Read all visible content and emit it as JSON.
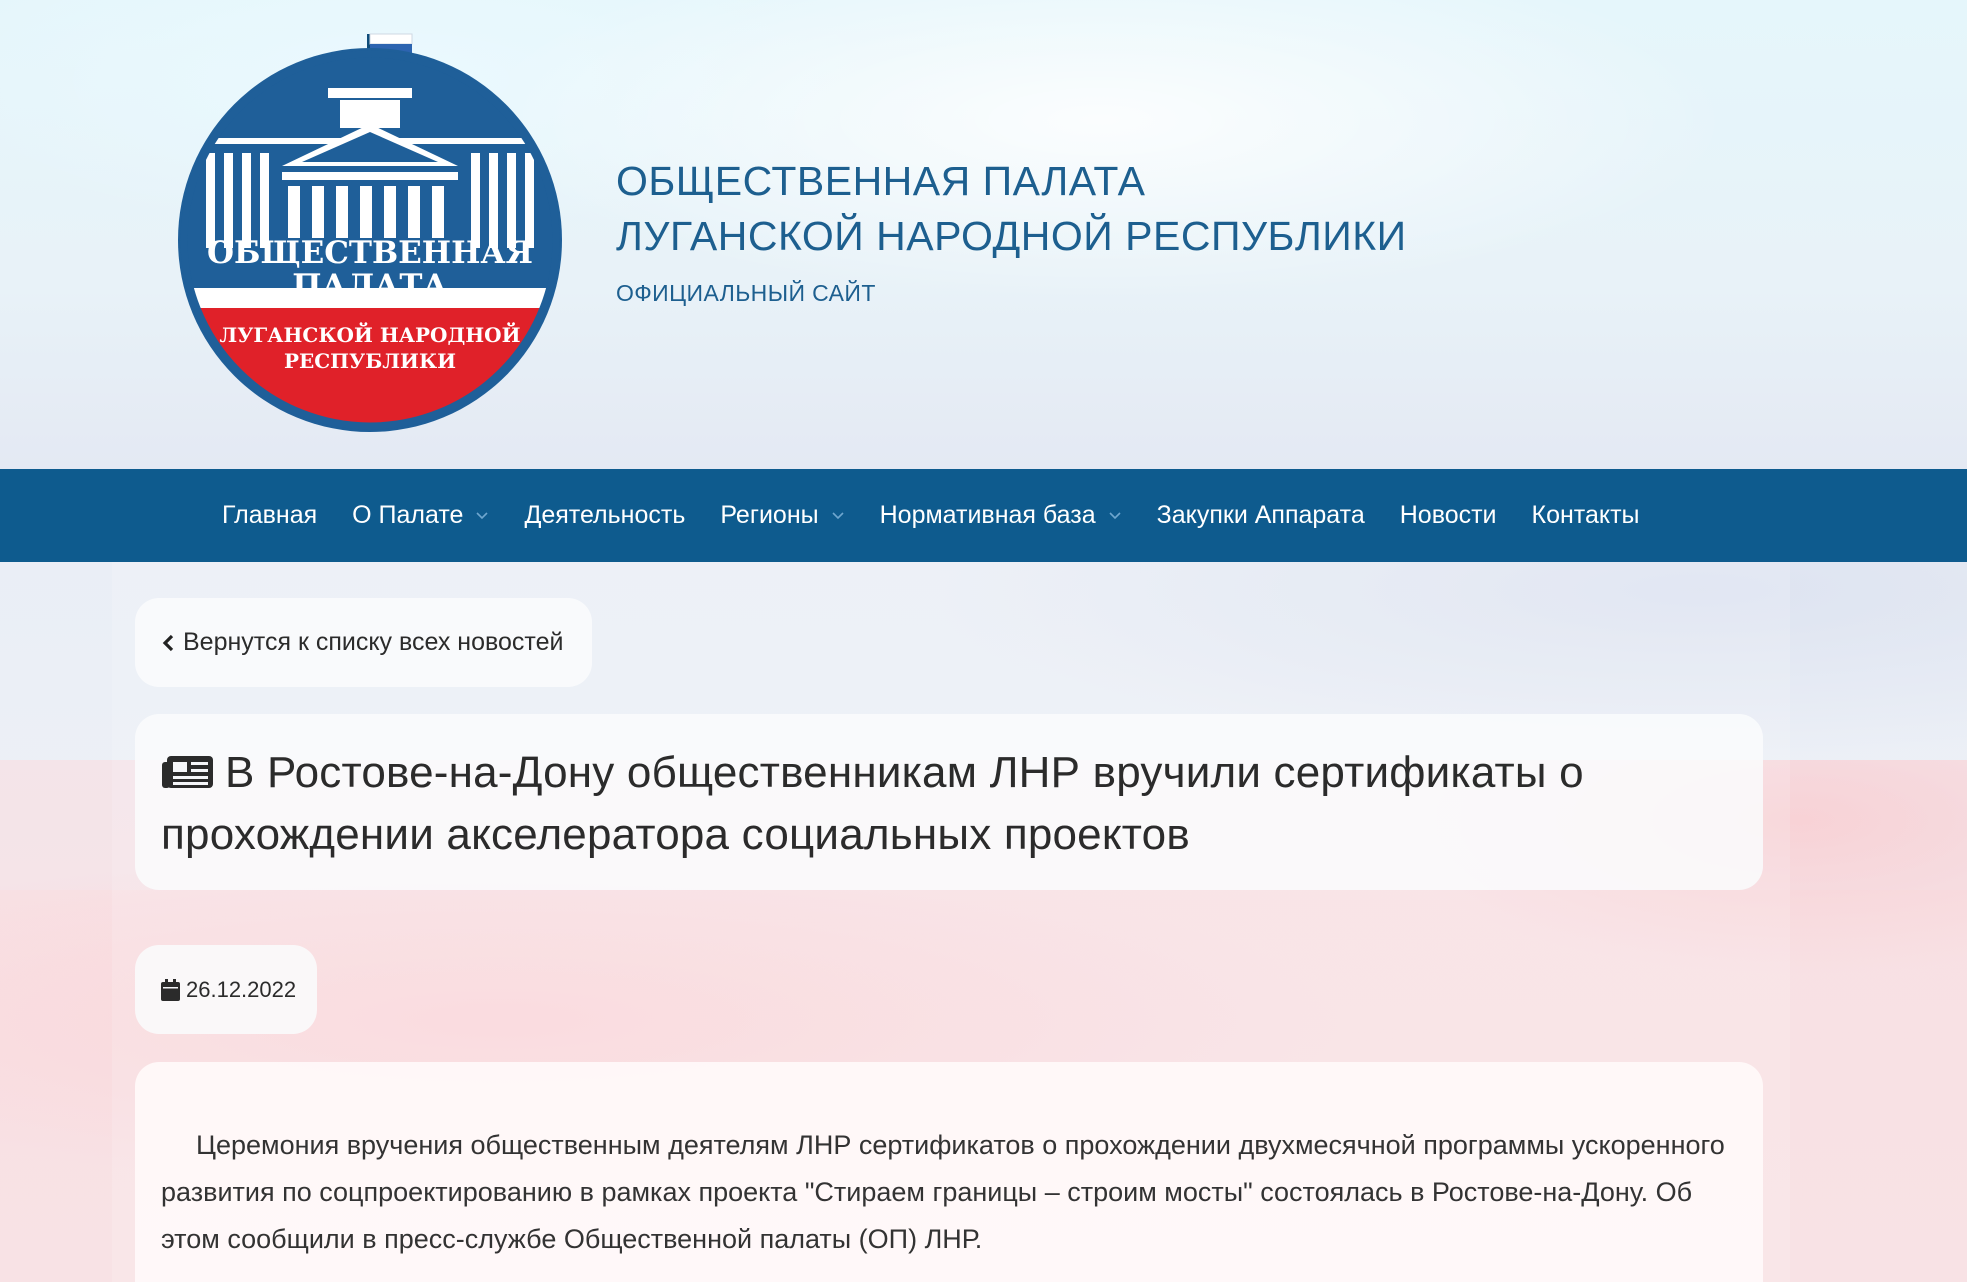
{
  "header": {
    "title_line1": "ОБЩЕСТВЕННАЯ ПАЛАТА",
    "title_line2": "ЛУГАНСКОЙ НАРОДНОЙ РЕСПУБЛИКИ",
    "subtitle": "ОФИЦИАЛЬНЫЙ САЙТ",
    "logo": {
      "line1": "ОБЩЕСТВЕННАЯ",
      "line2": "ПАЛАТА",
      "line3": "ЛУГАНСКОЙ НАРОДНОЙ",
      "line4": "РЕСПУБЛИКИ"
    }
  },
  "nav": {
    "items": [
      {
        "label": "Главная",
        "dropdown": false
      },
      {
        "label": "О Палате",
        "dropdown": true
      },
      {
        "label": "Деятельность",
        "dropdown": false
      },
      {
        "label": "Регионы",
        "dropdown": true
      },
      {
        "label": "Нормативная база",
        "dropdown": true
      },
      {
        "label": "Закупки Аппарата",
        "dropdown": false
      },
      {
        "label": "Новости",
        "dropdown": false
      },
      {
        "label": "Контакты",
        "dropdown": false
      }
    ]
  },
  "article": {
    "back_label": "Вернутся к списку всех новостей",
    "title": "В Ростове-на-Дону общественникам ЛНР вручили сертификаты о прохождении акселератора социальных проектов",
    "date": "26.12.2022",
    "body": "Церемония вручения общественным деятелям ЛНР сертификатов о прохождении двухмесячной программы ускоренного развития по соцпроектированию в рамках проекта \"Стираем границы – строим мосты\" состоялась в Ростове-на-Дону. Об этом сообщили в пресс-службе Общественной палаты (ОП) ЛНР."
  },
  "colors": {
    "nav_bg": "#0e5b8e",
    "title_blue": "#1d5f8f",
    "logo_blue": "#1f5f99",
    "logo_red": "#e02129"
  },
  "icons": {
    "back": "chevron-left-icon",
    "title": "newspaper-icon",
    "date": "calendar-icon",
    "dropdown": "chevron-down-icon"
  }
}
